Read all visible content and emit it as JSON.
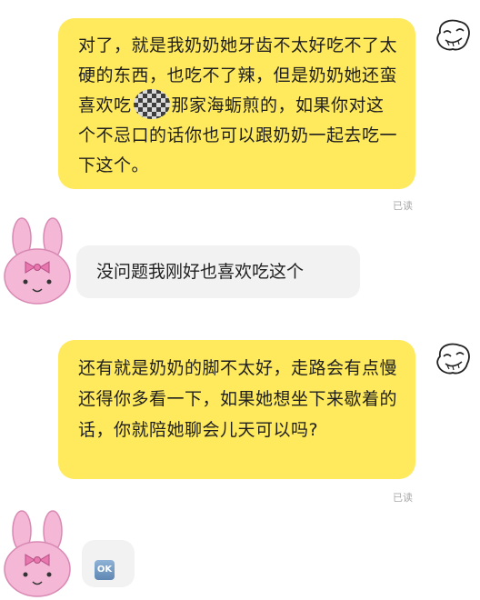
{
  "messages": [
    {
      "sender": "me",
      "text_before_blur": "对了，就是我奶奶她牙齿不太好吃不了太硬的东西，也吃不了辣，但是奶奶她还蛮喜欢吃",
      "text_after_blur": "那家海蛎煎的，如果你对这个不忌口的话你也可以跟奶奶一起去吃一下这个。",
      "read_status": "已读"
    },
    {
      "sender": "other",
      "text": "没问题我刚好也喜欢吃这个"
    },
    {
      "sender": "me",
      "text": "还有就是奶奶的脚不太好，走路会有点慢还得你多看一下，如果她想坐下来歇着的话，你就陪她聊会儿天可以吗?",
      "read_status": "已读"
    },
    {
      "sender": "other",
      "emoji_label": "OK"
    }
  ],
  "colors": {
    "my_bubble": "#FFE95C",
    "other_bubble": "#F2F2F2",
    "read_text": "#A9A9A9",
    "avatar_pink": "#F4B8D6"
  },
  "icons": {
    "my_avatar": "meme-face-icon",
    "other_avatar": "pink-bunny-icon",
    "blur": "pixelated-mosaic",
    "ok": "ok-emoji"
  }
}
